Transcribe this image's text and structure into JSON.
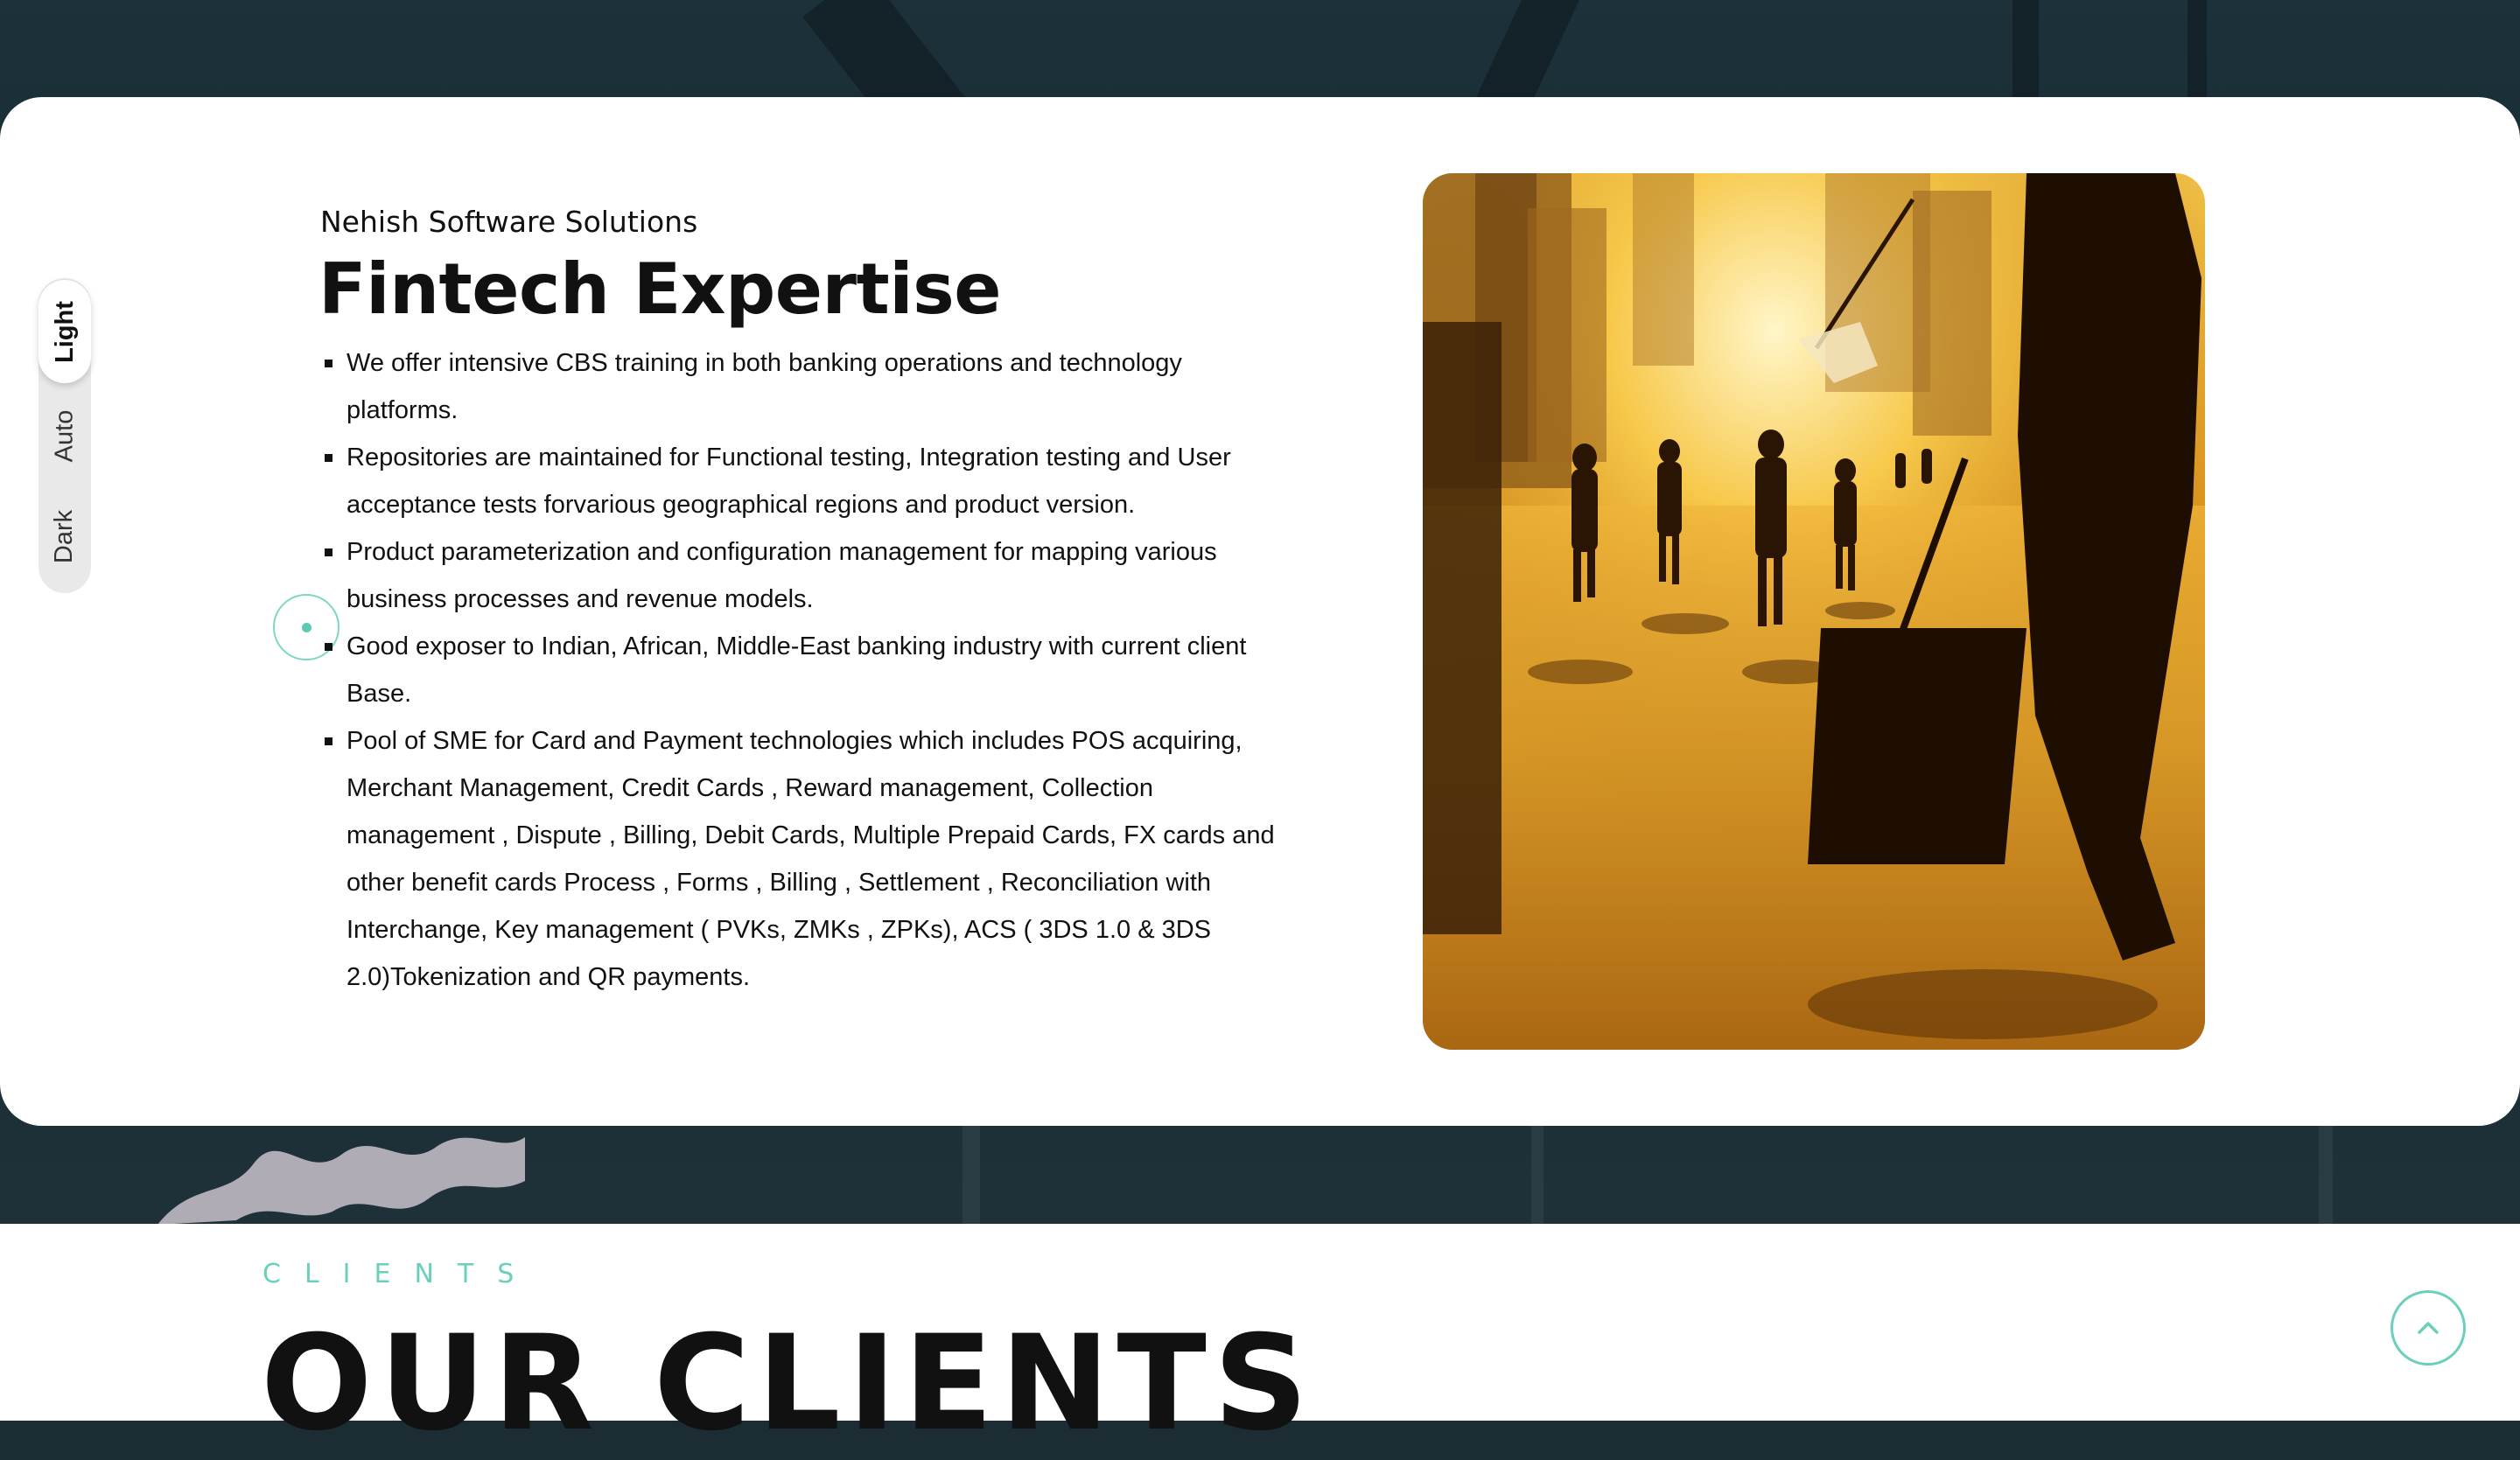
{
  "theme_switcher": {
    "options": [
      "Light",
      "Auto",
      "Dark"
    ],
    "active": "Light"
  },
  "fintech": {
    "company": "Nehish Software Solutions",
    "title": "Fintech Expertise",
    "bullets": [
      "We offer intensive CBS training in both banking operations and technology platforms.",
      "Repositories are maintained for Functional testing, Integration testing and User acceptance tests forvarious geographical regions and product version.",
      "Product parameterization and configuration management for mapping various business processes and revenue models.",
      "Good exposer to Indian, African, Middle-East banking industry with current client Base.",
      "Pool of SME for Card and Payment technologies which includes POS acquiring, Merchant Management, Credit Cards , Reward management, Collection management , Dispute , Billing, Debit Cards, Multiple Prepaid Cards, FX cards and other benefit cards Process , Forms , Billing , Settlement , Reconciliation with Interchange, Key management ( PVKs, ZMKs , ZPKs), ACS ( 3DS 1.0 & 3DS 2.0)Tokenization and QR payments."
    ]
  },
  "clients": {
    "kicker": "CLIENTS",
    "title": "OUR CLIENTS"
  },
  "icons": {
    "scroll_top": "chevron-up-icon",
    "cursor": "cursor-ring"
  },
  "colors": {
    "accent": "#6ccfbb",
    "card_background": "#ffffff",
    "page_background": "#1b2c33",
    "text": "#111111"
  }
}
